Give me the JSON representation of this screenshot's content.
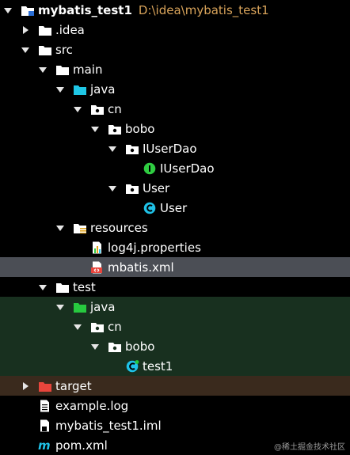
{
  "project": {
    "name": "mybatis_test1",
    "path": "D:\\idea\\mybatis_test1"
  },
  "nodes": {
    "idea": ".idea",
    "src": "src",
    "main": "main",
    "java_main": "java",
    "cn_main": "cn",
    "bobo_main": "bobo",
    "iuserdao_pkg": "IUserDao",
    "iuserdao_iface": "IUserDao",
    "user_pkg": "User",
    "user_class": "User",
    "resources": "resources",
    "log4j": "log4j.properties",
    "mbatis": "mbatis.xml",
    "test": "test",
    "java_test": "java",
    "cn_test": "cn",
    "bobo_test": "bobo",
    "test1": "test1",
    "target": "target",
    "example_log": "example.log",
    "iml": "mybatis_test1.iml",
    "pom": "pom.xml"
  },
  "watermark": "@稀土掘金技术社区",
  "colors": {
    "selected_row": "#4b4e55",
    "test_zone": "#18301f",
    "excluded_zone": "#3a2a1d",
    "source_folder": "#1fc7e6",
    "test_folder": "#27c93f",
    "excluded_folder": "#e8453c",
    "interface_badge": "#2fcc41",
    "class_badge": "#1fc2e8",
    "path_text": "#d8a35a"
  }
}
